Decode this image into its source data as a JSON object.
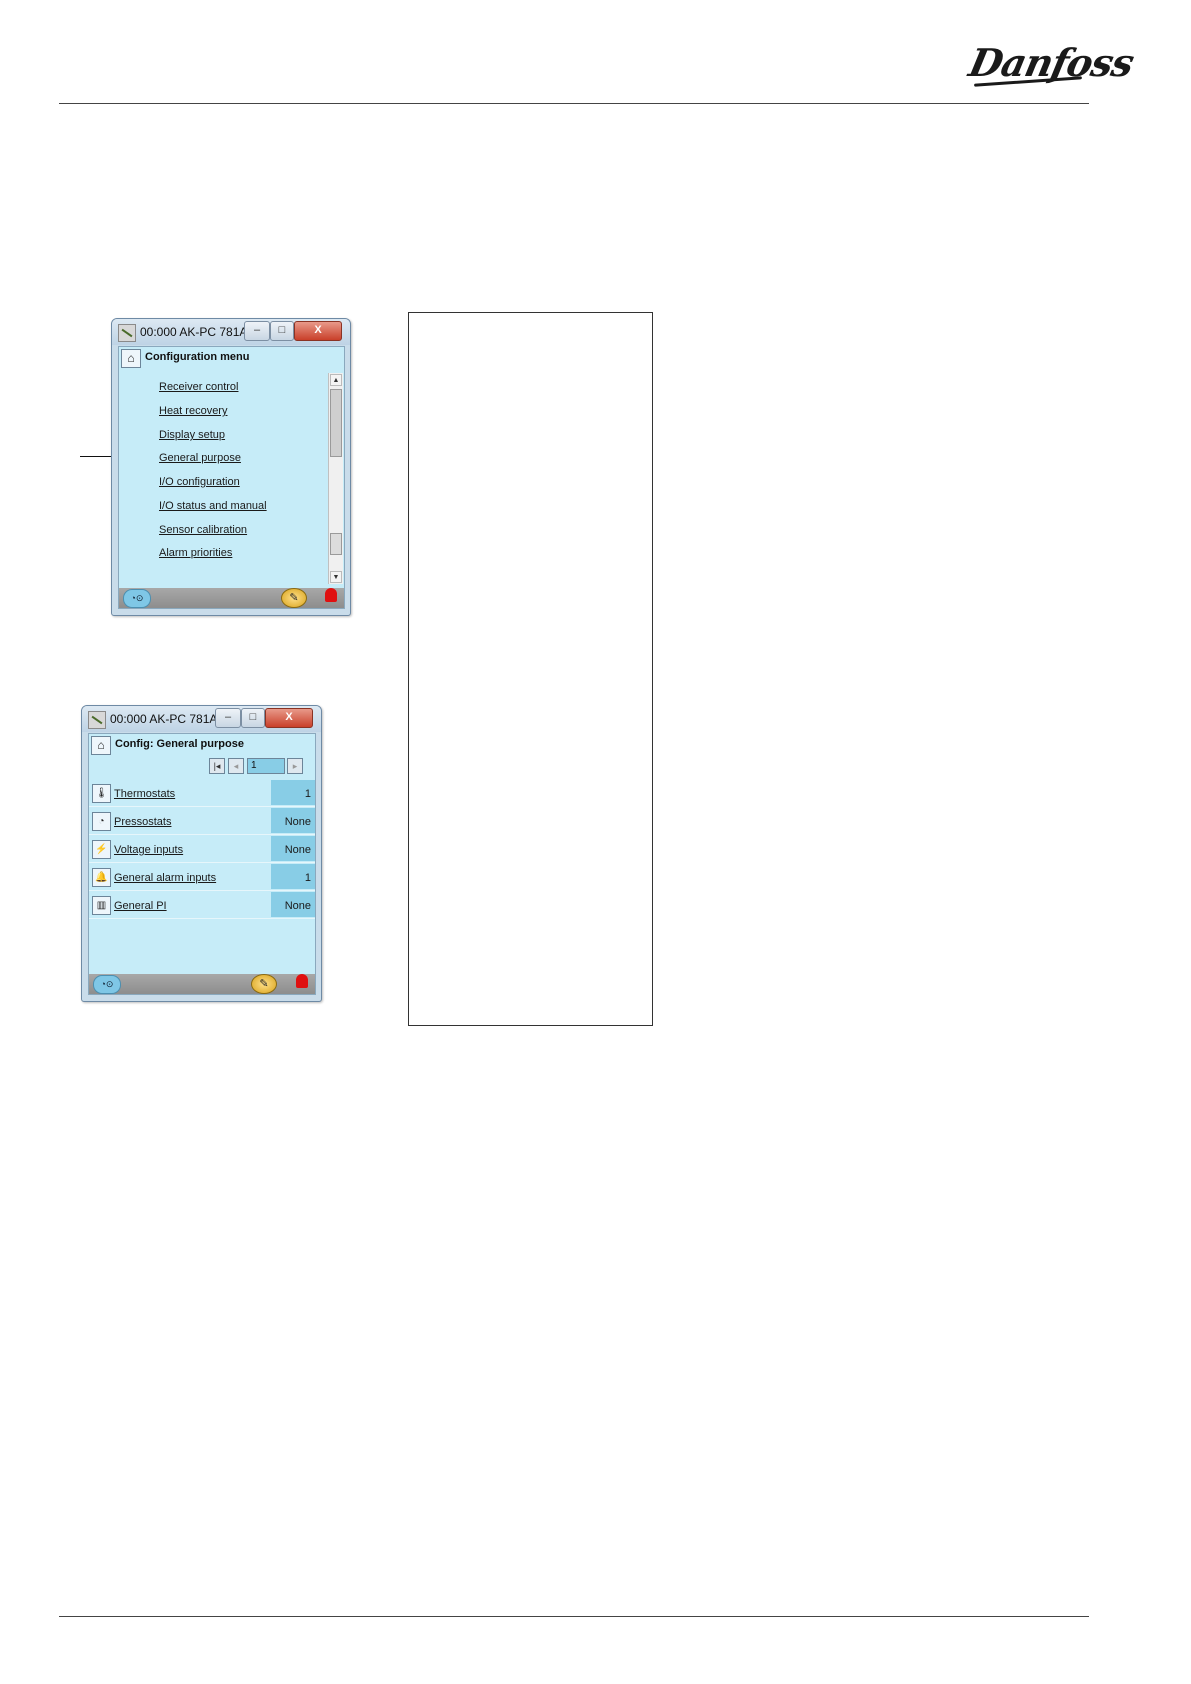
{
  "header": {
    "logo_text": "Danfoss"
  },
  "window1": {
    "title": "00:000 AK-PC 781A",
    "minimize_label": "–",
    "maximize_label": "□",
    "close_label": "X",
    "heading": "Configuration menu",
    "menu_items": [
      "Receiver control",
      "Heat recovery",
      "Display setup",
      "General purpose",
      "I/O configuration",
      "I/O status and manual",
      "Sensor calibration",
      "Alarm priorities"
    ],
    "scroll_up": "▲",
    "scroll_down": "▼"
  },
  "window2": {
    "title": "00:000 AK-PC 781A",
    "minimize_label": "–",
    "maximize_label": "□",
    "close_label": "X",
    "heading": "Config: General purpose",
    "nav_field_value": "1",
    "rows": [
      {
        "label": "Thermostats",
        "value": "1"
      },
      {
        "label": "Pressostats",
        "value": "None"
      },
      {
        "label": "Voltage inputs",
        "value": "None"
      },
      {
        "label": "General alarm inputs",
        "value": "1"
      },
      {
        "label": "General PI",
        "value": "None"
      }
    ]
  },
  "icons": {
    "home": "home-icon",
    "app": "app-icon",
    "wrench": "wrench-icon",
    "bell": "alarm-bell-icon",
    "status": "status-icon"
  },
  "colors": {
    "client_bg": "#c6ecf8",
    "value_cell": "#88cde6",
    "alarm_red": "#e01010",
    "close_red": "#c9402a"
  }
}
